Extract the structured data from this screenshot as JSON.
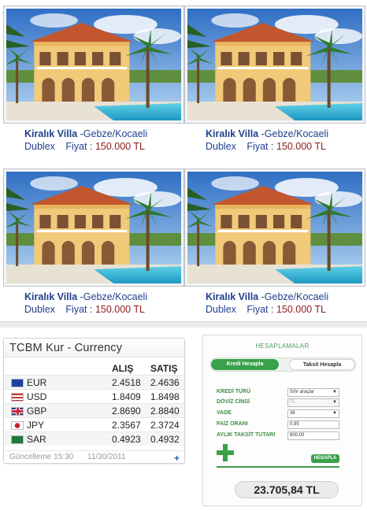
{
  "listings": [
    {
      "title_strong": "Kiralık Villa",
      "title_rest": " -Gebze/Kocaeli",
      "type": "Dublex",
      "price_label": "Fiyat :",
      "price": "150.000 TL"
    },
    {
      "title_strong": "Kiralık Villa",
      "title_rest": " -Gebze/Kocaeli",
      "type": "Dublex",
      "price_label": "Fiyat :",
      "price": "150.000 TL"
    },
    {
      "title_strong": "Kiralık Villa",
      "title_rest": " -Gebze/Kocaeli",
      "type": "Dublex",
      "price_label": "Fiyat :",
      "price": "150.000 TL"
    },
    {
      "title_strong": "Kiralık Villa",
      "title_rest": " -Gebze/Kocaeli",
      "type": "Dublex",
      "price_label": "Fiyat :",
      "price": "150.000 TL"
    }
  ],
  "currency": {
    "title": "TCBM Kur - Currency",
    "col_buy": "ALIŞ",
    "col_sell": "SATIŞ",
    "rows": [
      {
        "code": "EUR",
        "buy": "2.4518",
        "sell": "2.4636",
        "flag": "eu-flag-icon"
      },
      {
        "code": "USD",
        "buy": "1.8409",
        "sell": "1.8498",
        "flag": "us-flag-icon"
      },
      {
        "code": "GBP",
        "buy": "2.8690",
        "sell": "2.8840",
        "flag": "uk-flag-icon"
      },
      {
        "code": "JPY",
        "buy": "2.3567",
        "sell": "2.3724",
        "flag": "jp-flag-icon"
      },
      {
        "code": "SAR",
        "buy": "0.4923",
        "sell": "0.4932",
        "flag": "sa-flag-icon"
      }
    ],
    "updated_label": "Güncelleme 15:30",
    "updated_date": "11/30/2011",
    "more": "+"
  },
  "calculator": {
    "title": "HESAPLAMALAR",
    "tab_active": "Kredi Hesapla",
    "tab_idle": "Taksit Hesapla",
    "fields": [
      {
        "label": "KREDİ TÜRÜ",
        "value": "Sıfır araçlar",
        "select": true
      },
      {
        "label": "DÖVİZ CİNSİ",
        "value": "TL",
        "select": true
      },
      {
        "label": "VADE",
        "value": "36",
        "select": true
      },
      {
        "label": "FAİZ ORANI",
        "value": "0,95",
        "select": false
      },
      {
        "label": "AYLIK TAKSİT TUTARI",
        "value": "800,00",
        "select": false
      }
    ],
    "button": "HESAPLA",
    "result": "23.705,84 TL"
  },
  "colors": {
    "link": "#1f3f8c",
    "price": "#8b1b1b",
    "accent_green": "#3aa14a"
  }
}
